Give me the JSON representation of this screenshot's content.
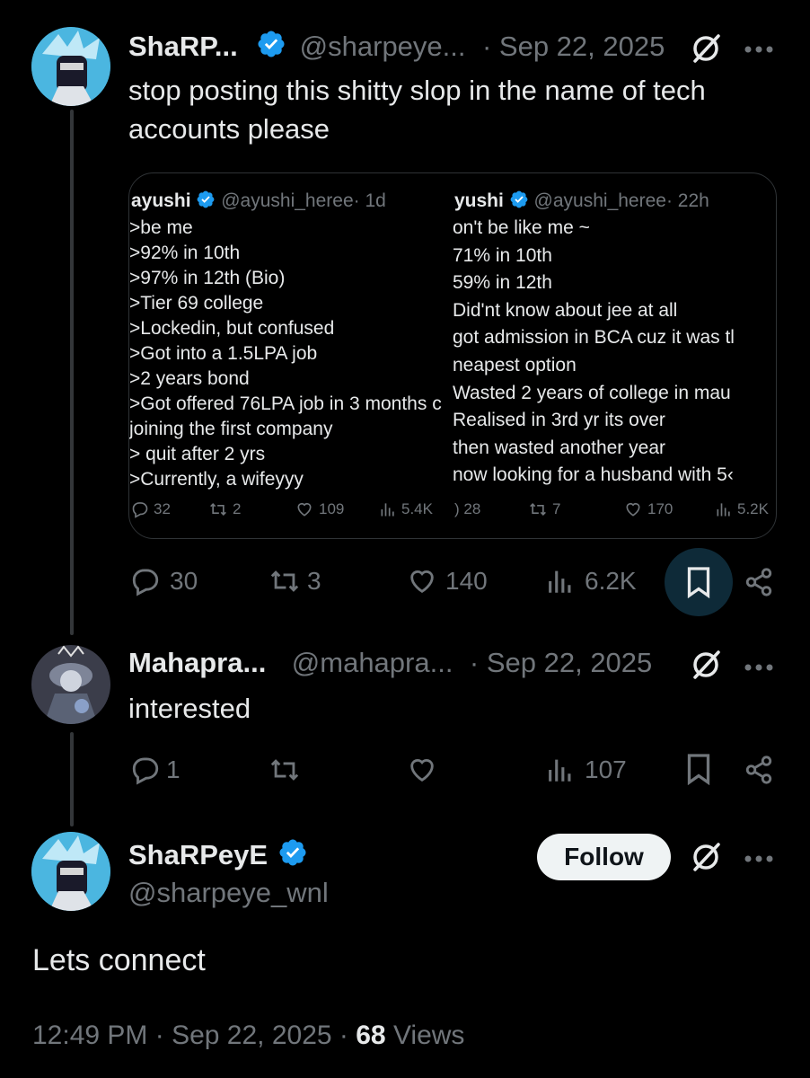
{
  "colors": {
    "background": "#000000",
    "text_primary": "#e7e9ea",
    "text_secondary": "#71767b",
    "verified_blue": "#1d9bf0",
    "bookmark_active_bg": "#0e2a38",
    "follow_bg": "#eff3f4"
  },
  "reply1": {
    "display_name": "ShaRP...",
    "handle": "@sharpeye...",
    "date": "· Sep 22, 2025",
    "text": "stop posting this shitty slop in the name of tech accounts please",
    "quoted_left": {
      "name": "ayushi",
      "handle": "@ayushi_heree",
      "time": "· 1d",
      "lines": [
        ">be me",
        ">92% in 10th",
        ">97% in 12th (Bio)",
        ">Tier 69 college",
        ">Lockedin, but confused",
        ">Got into a 1.5LPA job",
        ">2 years bond",
        ">Got offered 76LPA job in 3 months c",
        "joining the first company",
        "> quit after 2 yrs",
        ">Currently, a wifeyyy"
      ],
      "replies": "32",
      "reposts": "2",
      "likes": "109",
      "views": "5.4K"
    },
    "quoted_right": {
      "name": "yushi",
      "handle": "@ayushi_heree",
      "time": "· 22h",
      "lines": [
        "on't be like me ~",
        "71% in 10th",
        " 59% in 12th",
        "Did'nt know about jee at all",
        "got admission in BCA cuz it was tl",
        "neapest option",
        " Wasted 2 years of college in mau",
        " Realised in 3rd yr its over",
        " then wasted another year",
        " now looking for a husband with 5‹"
      ],
      "replies": ") 28",
      "reposts": "7",
      "likes": "170",
      "views": "5.2K"
    },
    "actions": {
      "replies": "30",
      "reposts": "3",
      "likes": "140",
      "views": "6.2K"
    }
  },
  "reply2": {
    "display_name": "Mahapra...",
    "handle": "@mahapra...",
    "date": "· Sep 22, 2025",
    "text": "interested",
    "actions": {
      "replies": "1",
      "reposts": "",
      "likes": "",
      "views": "107"
    }
  },
  "main_tweet": {
    "display_name": "ShaRPeyE",
    "handle": "@sharpeye_wnl",
    "follow_label": "Follow",
    "text": "Lets connect",
    "time": "12:49 PM · Sep 22, 2025 · ",
    "views_count": "68",
    "views_label": " Views"
  }
}
